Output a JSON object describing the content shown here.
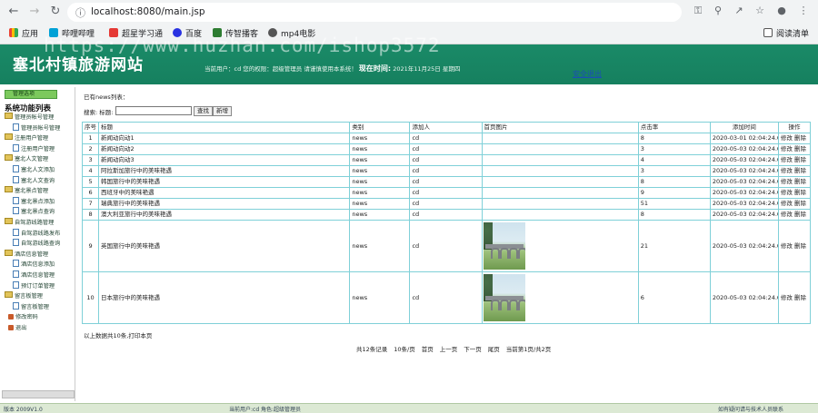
{
  "browser": {
    "url": "localhost:8080/main.jsp",
    "bookmarks": [
      "应用",
      "哔哩哔哩",
      "超星学习通",
      "百度",
      "传智播客",
      "mp4电影"
    ],
    "reading_list": "阅读清单"
  },
  "watermark": "https://www.huzhan.com/ishop3572",
  "header": {
    "title": "塞北村镇旅游网站",
    "user_info": "当前用户：cd 您的权限：超级管理员 请谨慎使用本系统！",
    "now_label": "现在时间:",
    "now_value": "2021年11月25日 星期四",
    "logout": "安全退出"
  },
  "sidebar": {
    "tab": "管理选项",
    "heading": "系统功能列表",
    "items": [
      {
        "label": "管理员帐号管理",
        "type": "folder"
      },
      {
        "label": "管理员帐号管理",
        "type": "page"
      },
      {
        "label": "注册用户管理",
        "type": "folder"
      },
      {
        "label": "注册用户管理",
        "type": "page"
      },
      {
        "label": "塞北人文管理",
        "type": "folder"
      },
      {
        "label": "塞北人文添加",
        "type": "page"
      },
      {
        "label": "塞北人文查询",
        "type": "page"
      },
      {
        "label": "塞北景点管理",
        "type": "folder"
      },
      {
        "label": "塞北景点添加",
        "type": "page"
      },
      {
        "label": "塞北景点查询",
        "type": "page"
      },
      {
        "label": "自驾游线路管理",
        "type": "folder"
      },
      {
        "label": "自驾游线路发布",
        "type": "page"
      },
      {
        "label": "自驾游线路查询",
        "type": "page"
      },
      {
        "label": "酒店信息管理",
        "type": "folder"
      },
      {
        "label": "酒店信息添加",
        "type": "page"
      },
      {
        "label": "酒店信息管理",
        "type": "page"
      },
      {
        "label": "预订订单管理",
        "type": "page"
      },
      {
        "label": "留言板管理",
        "type": "folder"
      },
      {
        "label": "留言板管理",
        "type": "page"
      },
      {
        "label": "修改密码",
        "type": "tool"
      },
      {
        "label": "退出",
        "type": "tool"
      }
    ]
  },
  "main": {
    "existing_label": "已有news列表：",
    "search_label": "搜索: 标题:",
    "search_button": "查找",
    "add_button": "新增",
    "columns": [
      "序号",
      "标题",
      "类别",
      "添加人",
      "首页图片",
      "点击率",
      "添加时间",
      "操作"
    ],
    "rows": [
      {
        "no": "1",
        "title": "新闻动向动1",
        "category": "news",
        "author": "cd",
        "image": false,
        "clicks": "8",
        "time": "2020-03-01 02:04:24.0",
        "ops": "修改 删除"
      },
      {
        "no": "2",
        "title": "新闻动向动2",
        "category": "news",
        "author": "cd",
        "image": false,
        "clicks": "3",
        "time": "2020-05-03 02:04:24.0",
        "ops": "修改 删除"
      },
      {
        "no": "3",
        "title": "新闻动向动3",
        "category": "news",
        "author": "cd",
        "image": false,
        "clicks": "4",
        "time": "2020-05-03 02:04:24.0",
        "ops": "修改 删除"
      },
      {
        "no": "4",
        "title": "阿拉斯加旅行中的美味艳遇",
        "category": "news",
        "author": "cd",
        "image": false,
        "clicks": "3",
        "time": "2020-05-03 02:04:24.0",
        "ops": "修改 删除"
      },
      {
        "no": "5",
        "title": "韩国旅行中的美味艳遇",
        "category": "news",
        "author": "cd",
        "image": false,
        "clicks": "8",
        "time": "2020-05-03 02:04:24.0",
        "ops": "修改 删除"
      },
      {
        "no": "6",
        "title": "西班牙中的美味艳遇",
        "category": "news",
        "author": "cd",
        "image": false,
        "clicks": "9",
        "time": "2020-05-03 02:04:24.0",
        "ops": "修改 删除"
      },
      {
        "no": "7",
        "title": "瑞典旅行中的美味艳遇",
        "category": "news",
        "author": "cd",
        "image": false,
        "clicks": "51",
        "time": "2020-05-03 02:04:24.0",
        "ops": "修改 删除"
      },
      {
        "no": "8",
        "title": "澳大利亚旅行中的美味艳遇",
        "category": "news",
        "author": "cd",
        "image": false,
        "clicks": "8",
        "time": "2020-05-03 02:04:24.0",
        "ops": "修改 删除"
      },
      {
        "no": "9",
        "title": "英国旅行中的美味艳遇",
        "category": "news",
        "author": "cd",
        "image": true,
        "clicks": "21",
        "time": "2020-05-03 02:04:24.0",
        "ops": "修改 删除"
      },
      {
        "no": "10",
        "title": "日本旅行中的美味艳遇",
        "category": "news",
        "author": "cd",
        "image": true,
        "clicks": "6",
        "time": "2020-05-03 02:04:24.0",
        "ops": "修改 删除"
      }
    ],
    "footer_note": "以上数据共10条,打印本页",
    "pager": [
      "共12条记录",
      "10条/页",
      "首页",
      "上一页",
      "下一页",
      "尾页",
      "当前第1页/共2页"
    ]
  },
  "status": {
    "left": "版本 2009V1.0",
    "middle": "当前用户:cd  角色:超级管理员",
    "right": "如有疑问请与技术人员联系"
  }
}
